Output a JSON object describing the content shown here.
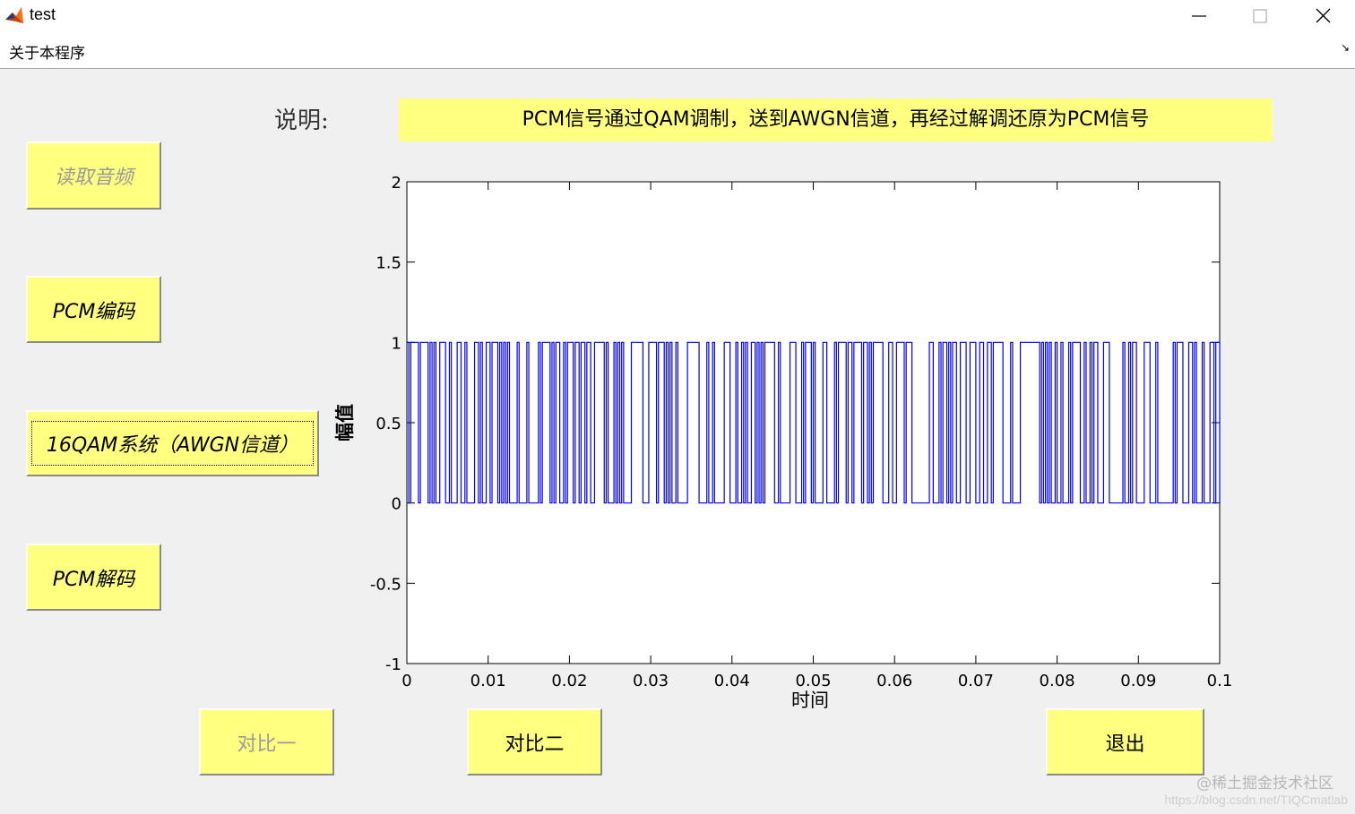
{
  "window": {
    "title": "test",
    "icon": "matlab-icon",
    "controls": [
      "minimize-icon",
      "maximize-icon",
      "close-icon"
    ]
  },
  "menu": {
    "items": [
      "关于本程序"
    ],
    "corner_icon": "dock-arrow-icon"
  },
  "description": {
    "label": "说明:",
    "text": "PCM信号通过QAM调制，送到AWGN信道，再经过解调还原为PCM信号"
  },
  "buttons": {
    "read_audio": "读取音频",
    "pcm_encode": "PCM编码",
    "qam_system": "16QAM系统（AWGN信道）",
    "pcm_decode": "PCM解码",
    "compare_one": "对比一",
    "compare_two": "对比二",
    "exit": "退出"
  },
  "colors": {
    "button_bg": "#ffff80",
    "signal_line": "#0000ff",
    "background": "#f0f0f0"
  },
  "chart_data": {
    "type": "line",
    "title": "",
    "xlabel": "时间",
    "ylabel": "幅值",
    "xlim": [
      0,
      0.1
    ],
    "ylim": [
      -1,
      2
    ],
    "xticks": [
      "0",
      "0.01",
      "0.02",
      "0.03",
      "0.04",
      "0.05",
      "0.06",
      "0.07",
      "0.08",
      "0.09",
      "0.1"
    ],
    "yticks": [
      "-1",
      "-0.5",
      "0",
      "0.5",
      "1",
      "1.5",
      "2"
    ],
    "grid": false,
    "legend": "none",
    "series": [
      {
        "description": "PCM binary bit stream, stairs plot, values alternating between 0 and 1",
        "levels": [
          0,
          1
        ],
        "x_range": [
          0,
          0.1
        ]
      }
    ]
  },
  "watermark": {
    "line1": "@稀土掘金技术社区",
    "line2": "https://blog.csdn.net/TIQCmatlab"
  }
}
